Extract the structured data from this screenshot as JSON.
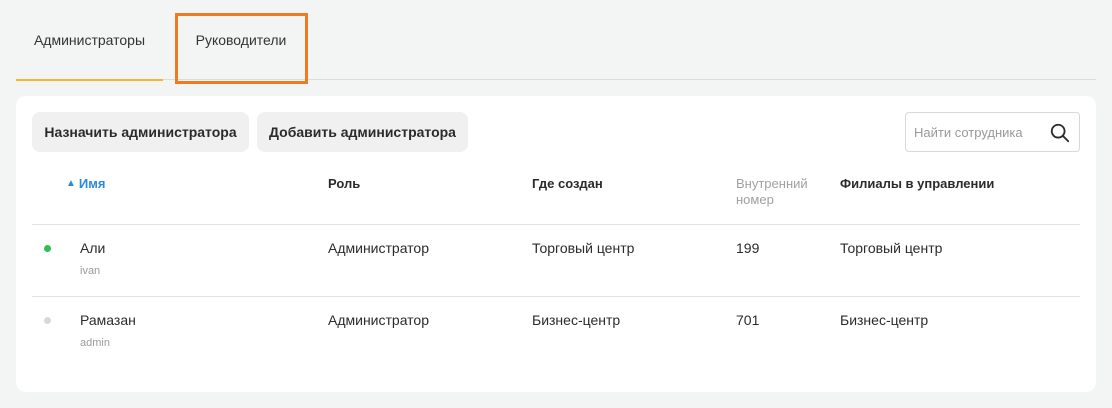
{
  "tabs": [
    {
      "label": "Администраторы",
      "active": true
    },
    {
      "label": "Руководители",
      "active": false
    }
  ],
  "toolbar": {
    "assign_label": "Назначить администратора",
    "add_label": "Добавить администратора"
  },
  "search": {
    "placeholder": "Найти сотрудника",
    "icon": "search-icon"
  },
  "table": {
    "columns": {
      "name": "Имя",
      "role": "Роль",
      "created": "Где создан",
      "ext_number": "Внутренний номер",
      "branches": "Филиалы в управлении"
    },
    "sort": {
      "column": "name",
      "direction": "asc",
      "icon": "▲"
    },
    "rows": [
      {
        "name": "Али",
        "login": "ivan",
        "role": "Администратор",
        "created": "Торговый центр",
        "ext_number": "199",
        "branches": "Торговый центр",
        "status_color": "#2fbf4a"
      },
      {
        "name": "Рамазан",
        "login": "admin",
        "role": "Администратор",
        "created": "Бизнес-центр",
        "ext_number": "701",
        "branches": "Бизнес-центр",
        "status_color": "#d5d8e0"
      }
    ]
  },
  "colors": {
    "accent_tab_underline": "#f5b431",
    "highlight_box": "#f07a1f",
    "sort_link": "#2a8ae0"
  }
}
